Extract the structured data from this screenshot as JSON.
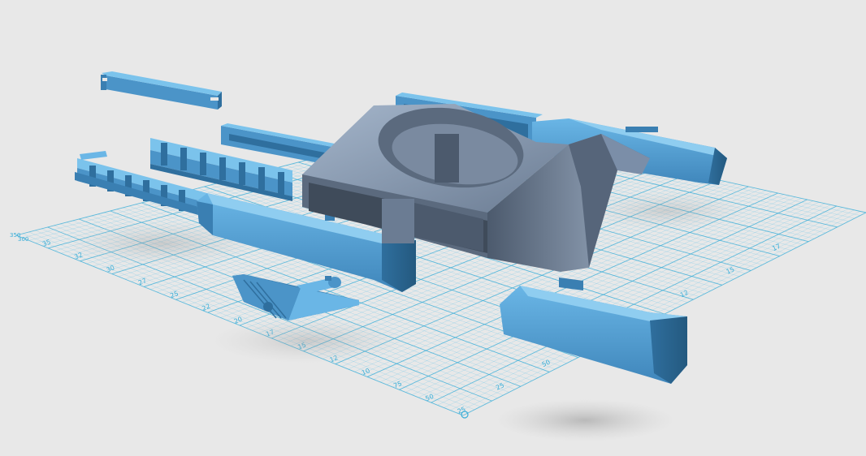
{
  "viewport": {
    "background": "#e8e8e8",
    "grid": {
      "line_color": "#62c3e8",
      "major_line_color": "#3aaed8",
      "label_color": "#3aaed8"
    },
    "model": {
      "part_color": "#4b94c8",
      "part_highlight": "#6ab6e6",
      "part_shadow": "#2f6f9e",
      "selected_part_color": "#7b8ea8"
    },
    "left_axis_labels": [
      "35",
      "32",
      "30",
      "27",
      "25",
      "22",
      "20",
      "17",
      "15",
      "12",
      "10",
      "75",
      "50",
      "25"
    ],
    "front_axis_labels": [
      "25",
      "50",
      "75",
      "10",
      "12",
      "15",
      "17"
    ],
    "corner_labels": [
      "350",
      "300"
    ]
  },
  "parts": [
    {
      "name": "connector-rail",
      "kind": "rail"
    },
    {
      "name": "ladder-bracket",
      "kind": "bracket"
    },
    {
      "name": "rib-frame",
      "kind": "frame"
    },
    {
      "name": "back-panel",
      "kind": "panel"
    },
    {
      "name": "rear-right-pod",
      "kind": "pod"
    },
    {
      "name": "front-left-pod",
      "kind": "pod"
    },
    {
      "name": "front-right-pod",
      "kind": "pod"
    },
    {
      "name": "main-chassis",
      "kind": "chassis"
    },
    {
      "name": "small-wedge-part",
      "kind": "wedge"
    },
    {
      "name": "small-pin-part",
      "kind": "pin"
    }
  ]
}
